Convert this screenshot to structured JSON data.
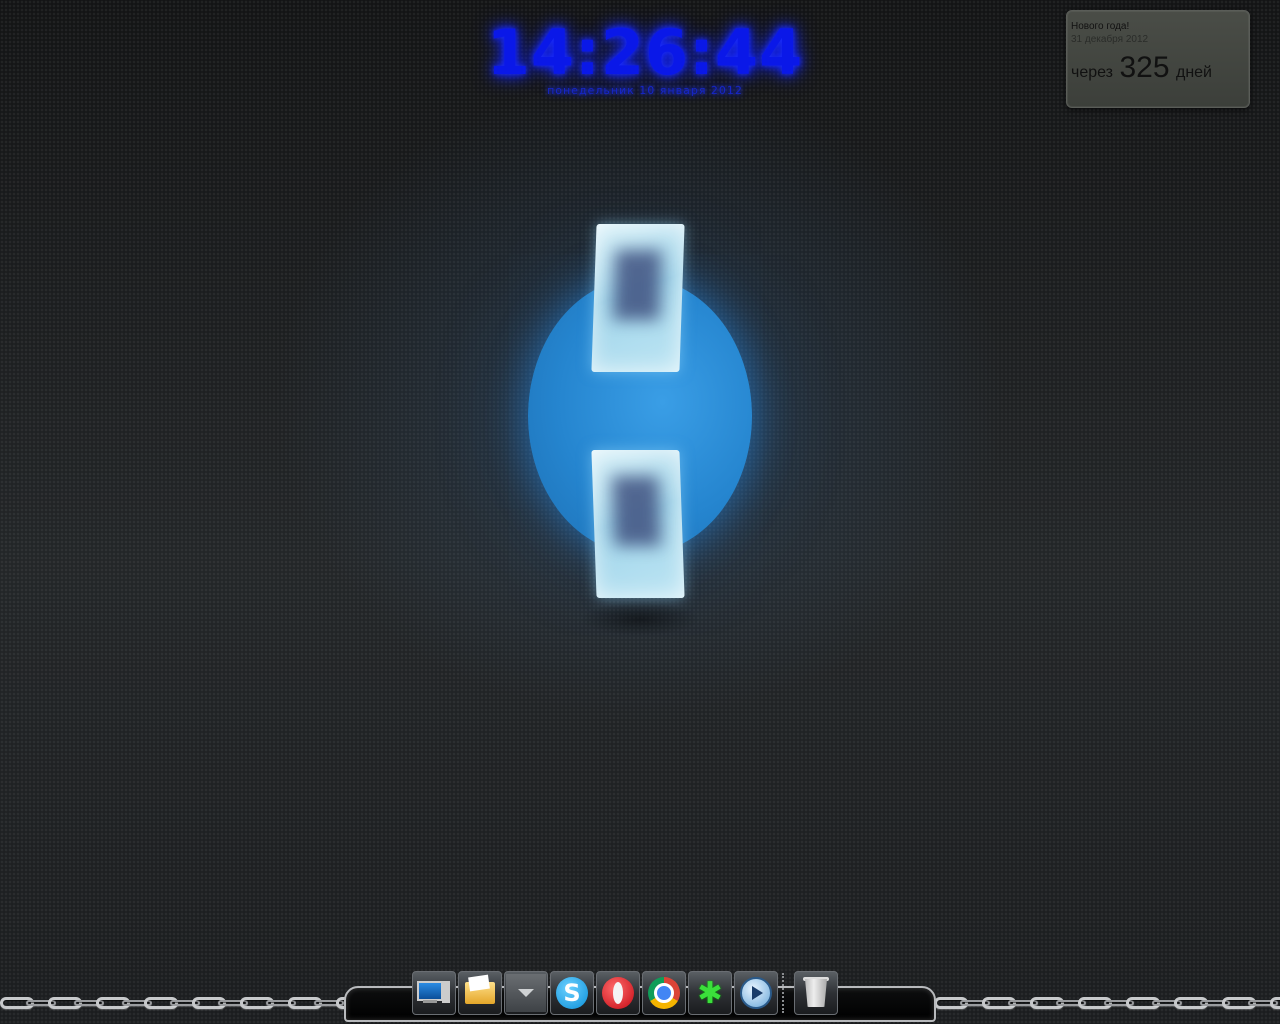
{
  "clock": {
    "time": "14:26:44",
    "date": "понедельник 10 января 2012"
  },
  "countdown": {
    "title": "Нового года!",
    "date": "31 декабря 2012",
    "prefix": "через",
    "number": "325",
    "suffix": "дней"
  },
  "dock": {
    "items": [
      {
        "name": "computer",
        "icon": "computer-icon"
      },
      {
        "name": "documents-folder",
        "icon": "folder-icon"
      },
      {
        "name": "stack",
        "icon": "arrow-down-icon"
      },
      {
        "name": "skype",
        "icon": "skype-icon",
        "glyph": "S"
      },
      {
        "name": "opera",
        "icon": "opera-icon"
      },
      {
        "name": "chrome",
        "icon": "chrome-icon"
      },
      {
        "name": "icq",
        "icon": "icq-flower-icon",
        "glyph": "✱"
      },
      {
        "name": "media-player",
        "icon": "media-player-icon"
      },
      {
        "name": "recycle-bin",
        "icon": "trash-icon"
      }
    ]
  },
  "colors": {
    "clock": "#0a18e8",
    "logo_blue": "#2585cf",
    "background": "#1a1c1e"
  }
}
